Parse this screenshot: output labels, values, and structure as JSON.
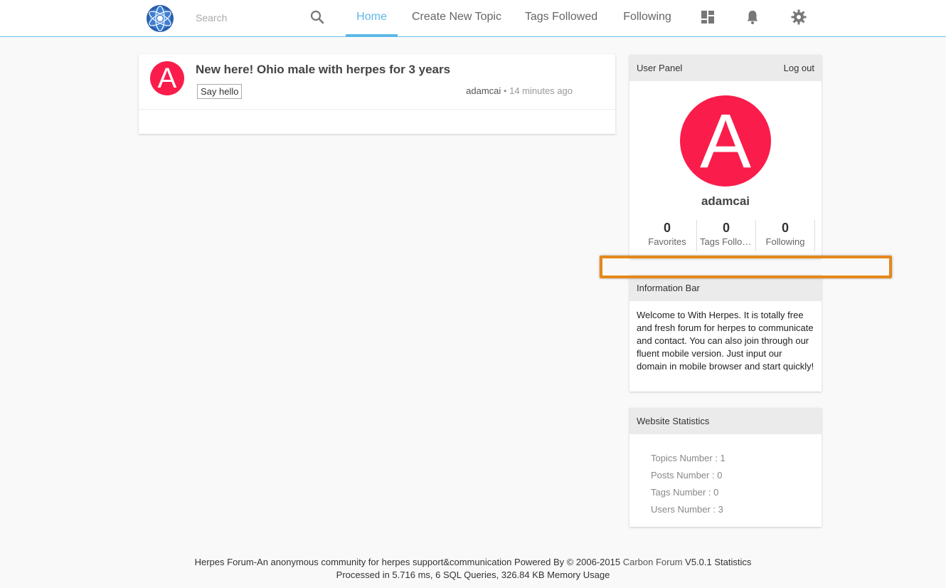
{
  "header": {
    "search_placeholder": "Search",
    "nav": {
      "home": "Home",
      "create_topic": "Create New Topic",
      "tags_followed": "Tags Followed",
      "following": "Following"
    },
    "icons": [
      "dashboard-icon",
      "bell-icon",
      "gear-icon"
    ],
    "accent_color": "#5cb8e6"
  },
  "topics": [
    {
      "avatar_letter": "A",
      "title": "New here! Ohio male with herpes for 3 years",
      "tag": "Say hello",
      "author": "adamcai",
      "separator": "•",
      "time": "14 minutes ago"
    }
  ],
  "user_panel": {
    "title": "User Panel",
    "logout": "Log out",
    "avatar_letter": "A",
    "avatar_color": "#fa1c4b",
    "username": "adamcai",
    "stats": [
      {
        "value": "0",
        "label": "Favorites"
      },
      {
        "value": "0",
        "label": "Tags Followed"
      },
      {
        "value": "0",
        "label": "Following"
      }
    ]
  },
  "info_bar": {
    "title": "Information Bar",
    "text": "Welcome to With Herpes. It is totally free and fresh forum for herpes to communicate and contact. You can also join through our fluent mobile version. Just input our domain in mobile browser and start quickly!"
  },
  "site_stats": {
    "title": "Website Statistics",
    "items": [
      "Topics Number : 1",
      "Posts Number : 0",
      "Tags Number : 0",
      "Users Number : 3"
    ]
  },
  "footer": {
    "line1_text": "Herpes Forum-An anonymous community for herpes support&communication Powered By © 2006-2015",
    "brand": "Carbon Forum",
    "version": "V5.0.1",
    "stats_link": "Statistics",
    "line2": "Processed in 5.716 ms, 6 SQL Queries, 326.84 KB Memory Usage"
  },
  "highlight_color": "#e5881b"
}
